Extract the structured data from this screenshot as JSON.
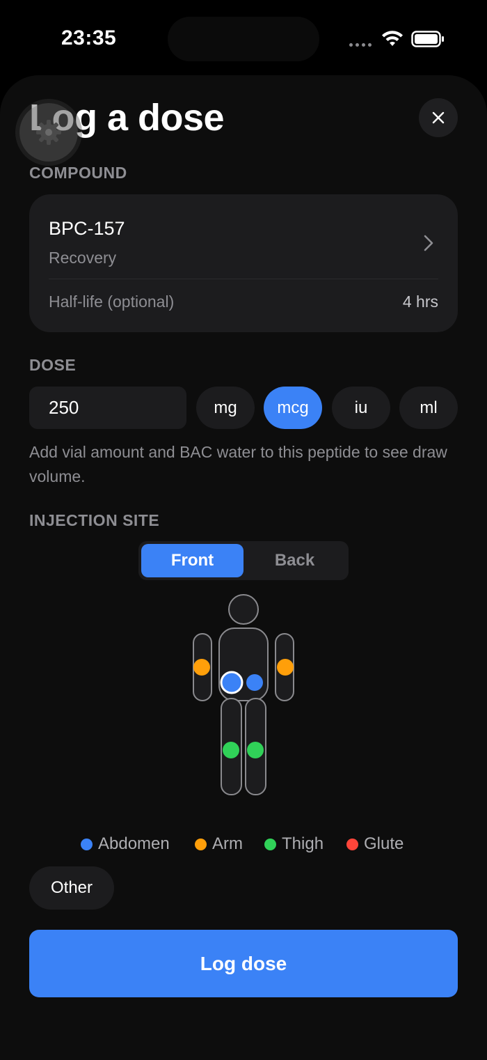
{
  "status_bar": {
    "time": "23:35"
  },
  "header": {
    "title": "Log a dose"
  },
  "compound": {
    "section_label": "COMPOUND",
    "name": "BPC-157",
    "category": "Recovery",
    "half_life_label": "Half-life (optional)",
    "half_life_value": "4 hrs"
  },
  "dose": {
    "section_label": "DOSE",
    "value": "250",
    "units": [
      "mg",
      "mcg",
      "iu",
      "ml"
    ],
    "selected_unit": "mcg",
    "hint": "Add vial amount and BAC water to this peptide to see draw volume."
  },
  "injection_site": {
    "section_label": "INJECTION SITE",
    "views": [
      "Front",
      "Back"
    ],
    "selected_view": "Front",
    "legend": [
      {
        "label": "Abdomen",
        "color": "#3b82f6"
      },
      {
        "label": "Arm",
        "color": "#ff9f0a"
      },
      {
        "label": "Thigh",
        "color": "#30d158"
      },
      {
        "label": "Glute",
        "color": "#ff453a"
      }
    ],
    "other_label": "Other",
    "selected_site": "Abdomen (left)"
  },
  "actions": {
    "log_label": "Log dose"
  },
  "colors": {
    "accent": "#3b82f6",
    "background": "#000000",
    "card": "#1c1c1e"
  }
}
